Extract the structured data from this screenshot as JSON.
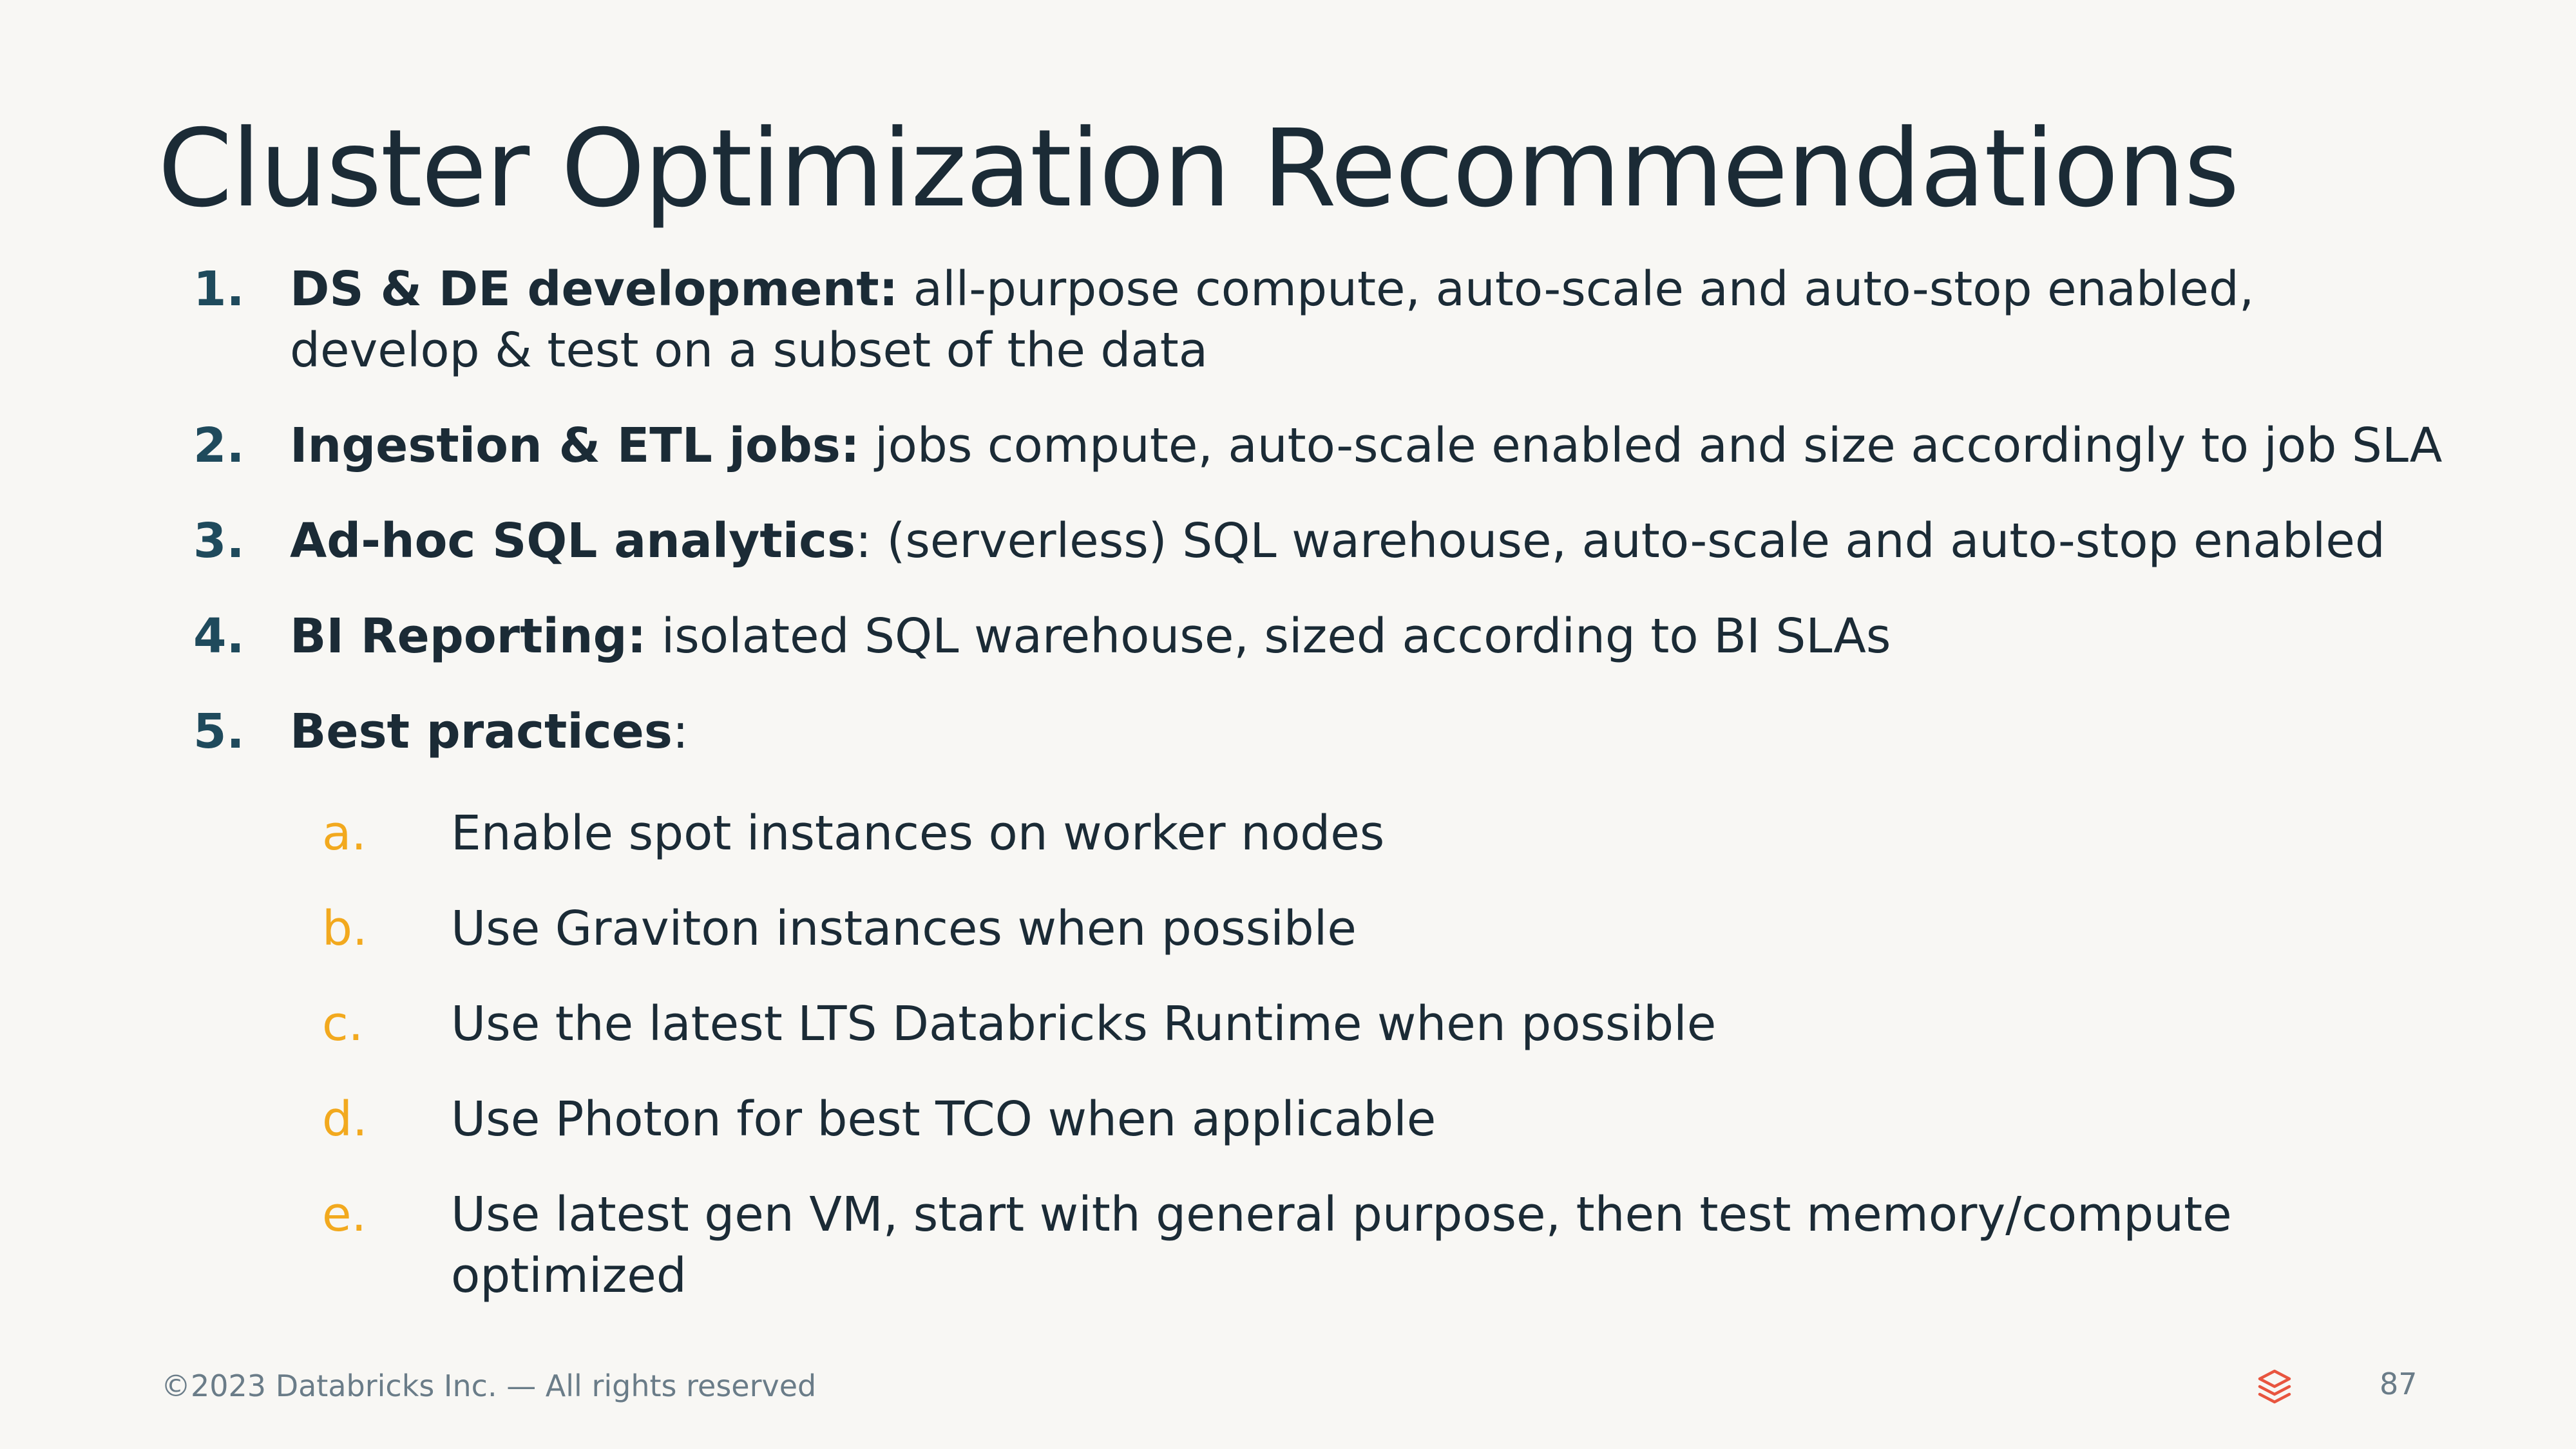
{
  "slide": {
    "title": "Cluster Optimization Recommendations",
    "items": [
      {
        "num": "1.",
        "label": "DS & DE development:",
        "text": " all-purpose compute, auto-scale and auto-stop enabled, develop & test on a subset of the data"
      },
      {
        "num": "2.",
        "label": "Ingestion & ETL jobs:",
        "text": " jobs compute, auto-scale enabled and size accordingly to job SLA"
      },
      {
        "num": "3.",
        "label": "Ad-hoc SQL analytics",
        "text": ": (serverless) SQL warehouse, auto-scale and auto-stop enabled"
      },
      {
        "num": "4.",
        "label": "BI Reporting:",
        "text": " isolated SQL warehouse, sized according to BI SLAs"
      },
      {
        "num": "5.",
        "label": "Best practices",
        "text": ":"
      }
    ],
    "sub_items": [
      {
        "letter": "a.",
        "text": "Enable spot instances on worker nodes"
      },
      {
        "letter": "b.",
        "text": "Use Graviton instances when possible"
      },
      {
        "letter": "c.",
        "text": "Use the latest LTS Databricks Runtime when possible"
      },
      {
        "letter": "d.",
        "text": "Use Photon for best TCO when applicable"
      },
      {
        "letter": "e.",
        "text": "Use latest gen VM, start with general purpose, then test memory/compute optimized"
      }
    ]
  },
  "footer": {
    "copyright": "©2023 Databricks Inc. — All rights reserved",
    "page_number": "87",
    "logo_icon": "databricks-logo-icon"
  },
  "colors": {
    "background": "#f8f7f4",
    "text": "#1b2b36",
    "number": "#1f4a5c",
    "sub_letter": "#f2a91e",
    "footer_text": "#6a7c88",
    "logo": "#e8553f"
  }
}
